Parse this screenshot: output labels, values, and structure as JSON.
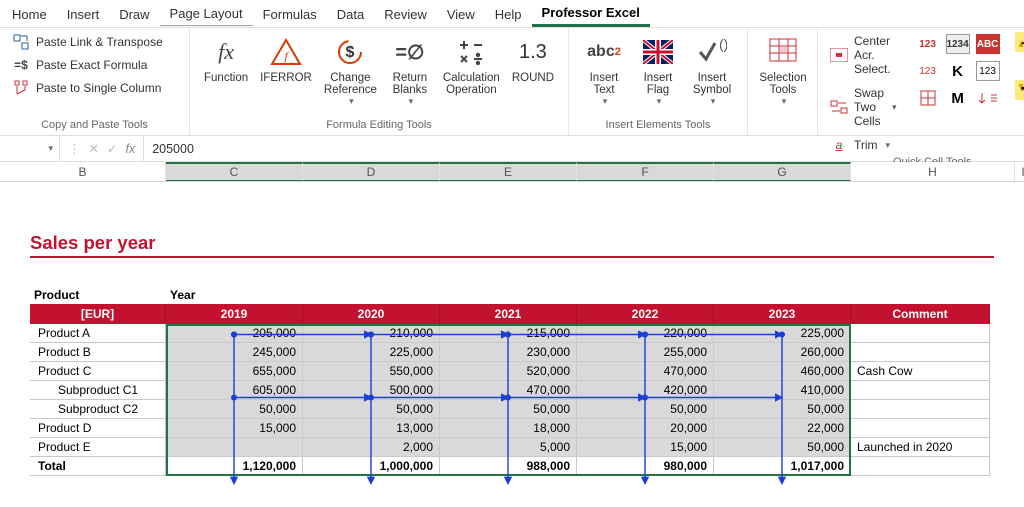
{
  "tabs": {
    "items": [
      "Home",
      "Insert",
      "Draw",
      "Page Layout",
      "Formulas",
      "Data",
      "Review",
      "View",
      "Help",
      "Professor Excel"
    ],
    "underline_idx": 3,
    "active_idx": 9
  },
  "ribbon": {
    "group1": {
      "label": "Copy and Paste Tools",
      "btn1": "Paste Link & Transpose",
      "btn2": "Paste Exact Formula",
      "btn3": "Paste to Single Column"
    },
    "group2": {
      "label": "Formula Editing Tools",
      "fn": "Function",
      "iferror": "IFERROR",
      "change_ref": "Change\nReference",
      "return_blanks": "Return\nBlanks",
      "calc_op": "Calculation\nOperation",
      "round": "ROUND"
    },
    "group3": {
      "label": "Insert Elements Tools",
      "ins_text": "Insert\nText",
      "ins_flag": "Insert\nFlag",
      "ins_symbol": "Insert\nSymbol"
    },
    "group4": {
      "label": "",
      "sel_tools": "Selection\nTools"
    },
    "group5": {
      "label": "Quick Cell Tools",
      "center": "Center Acr. Select.",
      "swap": "Swap Two Cells",
      "trim": "Trim"
    }
  },
  "formula_bar": {
    "fx": "fx",
    "value": "205000"
  },
  "colhdrs": [
    "B",
    "C",
    "D",
    "E",
    "F",
    "G",
    "H",
    "I"
  ],
  "sheet": {
    "title": "Sales per year",
    "product_label": "Product",
    "year_label": "Year",
    "eur_label": "[EUR]",
    "comment_label": "Comment",
    "years": [
      "2019",
      "2020",
      "2021",
      "2022",
      "2023"
    ],
    "rows": [
      {
        "name": "Product A",
        "v": [
          "205,000",
          "210,000",
          "215,000",
          "220,000",
          "225,000"
        ],
        "comment": ""
      },
      {
        "name": "Product B",
        "v": [
          "245,000",
          "225,000",
          "230,000",
          "255,000",
          "260,000"
        ],
        "comment": ""
      },
      {
        "name": "Product C",
        "v": [
          "655,000",
          "550,000",
          "520,000",
          "470,000",
          "460,000"
        ],
        "comment": "Cash Cow"
      },
      {
        "name": "Subproduct C1",
        "indent": true,
        "v": [
          "605,000",
          "500,000",
          "470,000",
          "420,000",
          "410,000"
        ],
        "comment": ""
      },
      {
        "name": "Subproduct C2",
        "indent": true,
        "v": [
          "50,000",
          "50,000",
          "50,000",
          "50,000",
          "50,000"
        ],
        "comment": ""
      },
      {
        "name": "Product D",
        "v": [
          "15,000",
          "13,000",
          "18,000",
          "20,000",
          "22,000"
        ],
        "comment": ""
      },
      {
        "name": "Product E",
        "v": [
          "",
          "2,000",
          "5,000",
          "15,000",
          "50,000"
        ],
        "comment": "Launched in 2020"
      }
    ],
    "total": {
      "name": "Total",
      "v": [
        "1,120,000",
        "1,000,000",
        "988,000",
        "980,000",
        "1,017,000"
      ],
      "comment": ""
    }
  },
  "chart_data": {
    "type": "table",
    "title": "Sales per year",
    "unit": "EUR",
    "columns": [
      "Product",
      "2019",
      "2020",
      "2021",
      "2022",
      "2023",
      "Comment"
    ],
    "rows": [
      [
        "Product A",
        205000,
        210000,
        215000,
        220000,
        225000,
        ""
      ],
      [
        "Product B",
        245000,
        225000,
        230000,
        255000,
        260000,
        ""
      ],
      [
        "Product C",
        655000,
        550000,
        520000,
        470000,
        460000,
        "Cash Cow"
      ],
      [
        "Subproduct C1",
        605000,
        500000,
        470000,
        420000,
        410000,
        ""
      ],
      [
        "Subproduct C2",
        50000,
        50000,
        50000,
        50000,
        50000,
        ""
      ],
      [
        "Product D",
        15000,
        13000,
        18000,
        20000,
        22000,
        ""
      ],
      [
        "Product E",
        null,
        2000,
        5000,
        15000,
        50000,
        "Launched in 2020"
      ],
      [
        "Total",
        1120000,
        1000000,
        988000,
        980000,
        1017000,
        ""
      ]
    ]
  }
}
